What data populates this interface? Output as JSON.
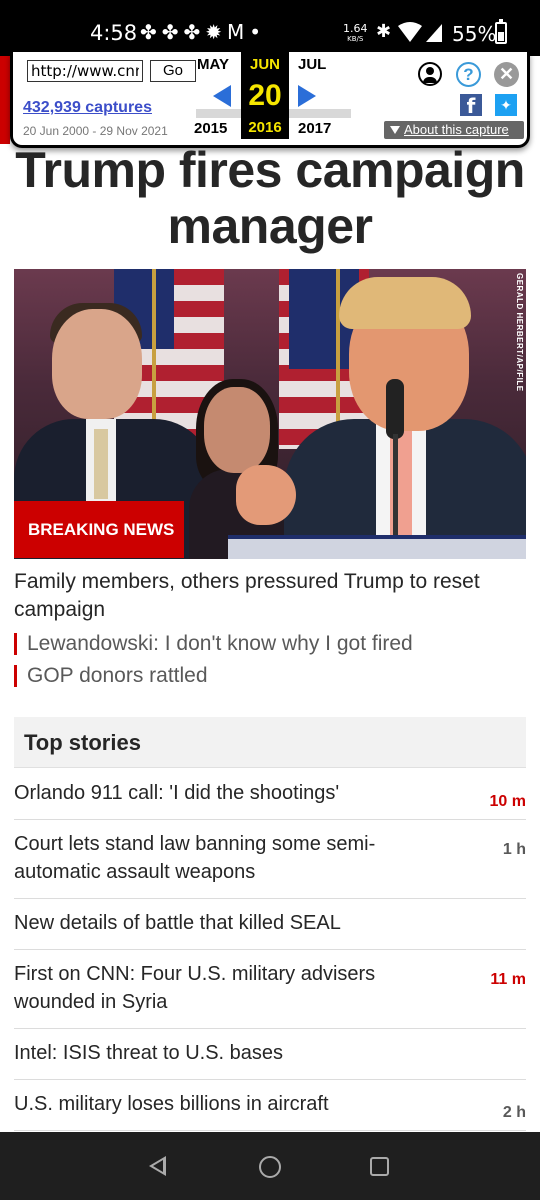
{
  "status_bar": {
    "time": "4:58",
    "notifications": "✤✤✤✹M•",
    "net_speed": "1.64",
    "net_unit": "KB/S",
    "bluetooth": "✱",
    "battery": "55%"
  },
  "wayback": {
    "url_value": "http://www.cnn.com",
    "go_label": "Go",
    "captures": "432,939 captures",
    "range": "20 Jun 2000 - 29 Nov 2021",
    "prev_month": "MAY",
    "current_month": "JUN",
    "next_month": "JUL",
    "current_day": "20",
    "prev_year": "2015",
    "current_year": "2016",
    "next_year": "2017",
    "help_glyph": "?",
    "close_glyph": "✕",
    "facebook_glyph": "f",
    "twitter_glyph": "✦",
    "about_label": "About this capture"
  },
  "article": {
    "headline": "Trump fires campaign manager",
    "photo_credit": "GERALD HERBERT/AP/FILE",
    "breaking_label": "BREAKING NEWS",
    "lead": "Family members, others pressured Trump to reset campaign",
    "related": [
      "Lewandowski: I don't know why I got fired",
      "GOP donors rattled"
    ]
  },
  "top_stories": {
    "title": "Top stories",
    "items": [
      {
        "title": "Orlando 911 call: 'I did the shootings'",
        "age": "10 m"
      },
      {
        "title": "Court lets stand law banning some semi-automatic assault weapons",
        "age": "1 h"
      },
      {
        "title": "New details of battle that killed SEAL",
        "age": ""
      },
      {
        "title": "First on CNN: Four U.S. military advisers wounded in Syria",
        "age": "11 m"
      },
      {
        "title": "Intel: ISIS threat to U.S. bases",
        "age": ""
      },
      {
        "title": "U.S. military loses billions in aircraft",
        "age": "2 h"
      }
    ]
  },
  "colors": {
    "accent_red": "#cc0000",
    "wayback_yellow": "#f6e600",
    "wayback_blue": "#2b6ed8",
    "link_blue": "#3c4ec9"
  }
}
